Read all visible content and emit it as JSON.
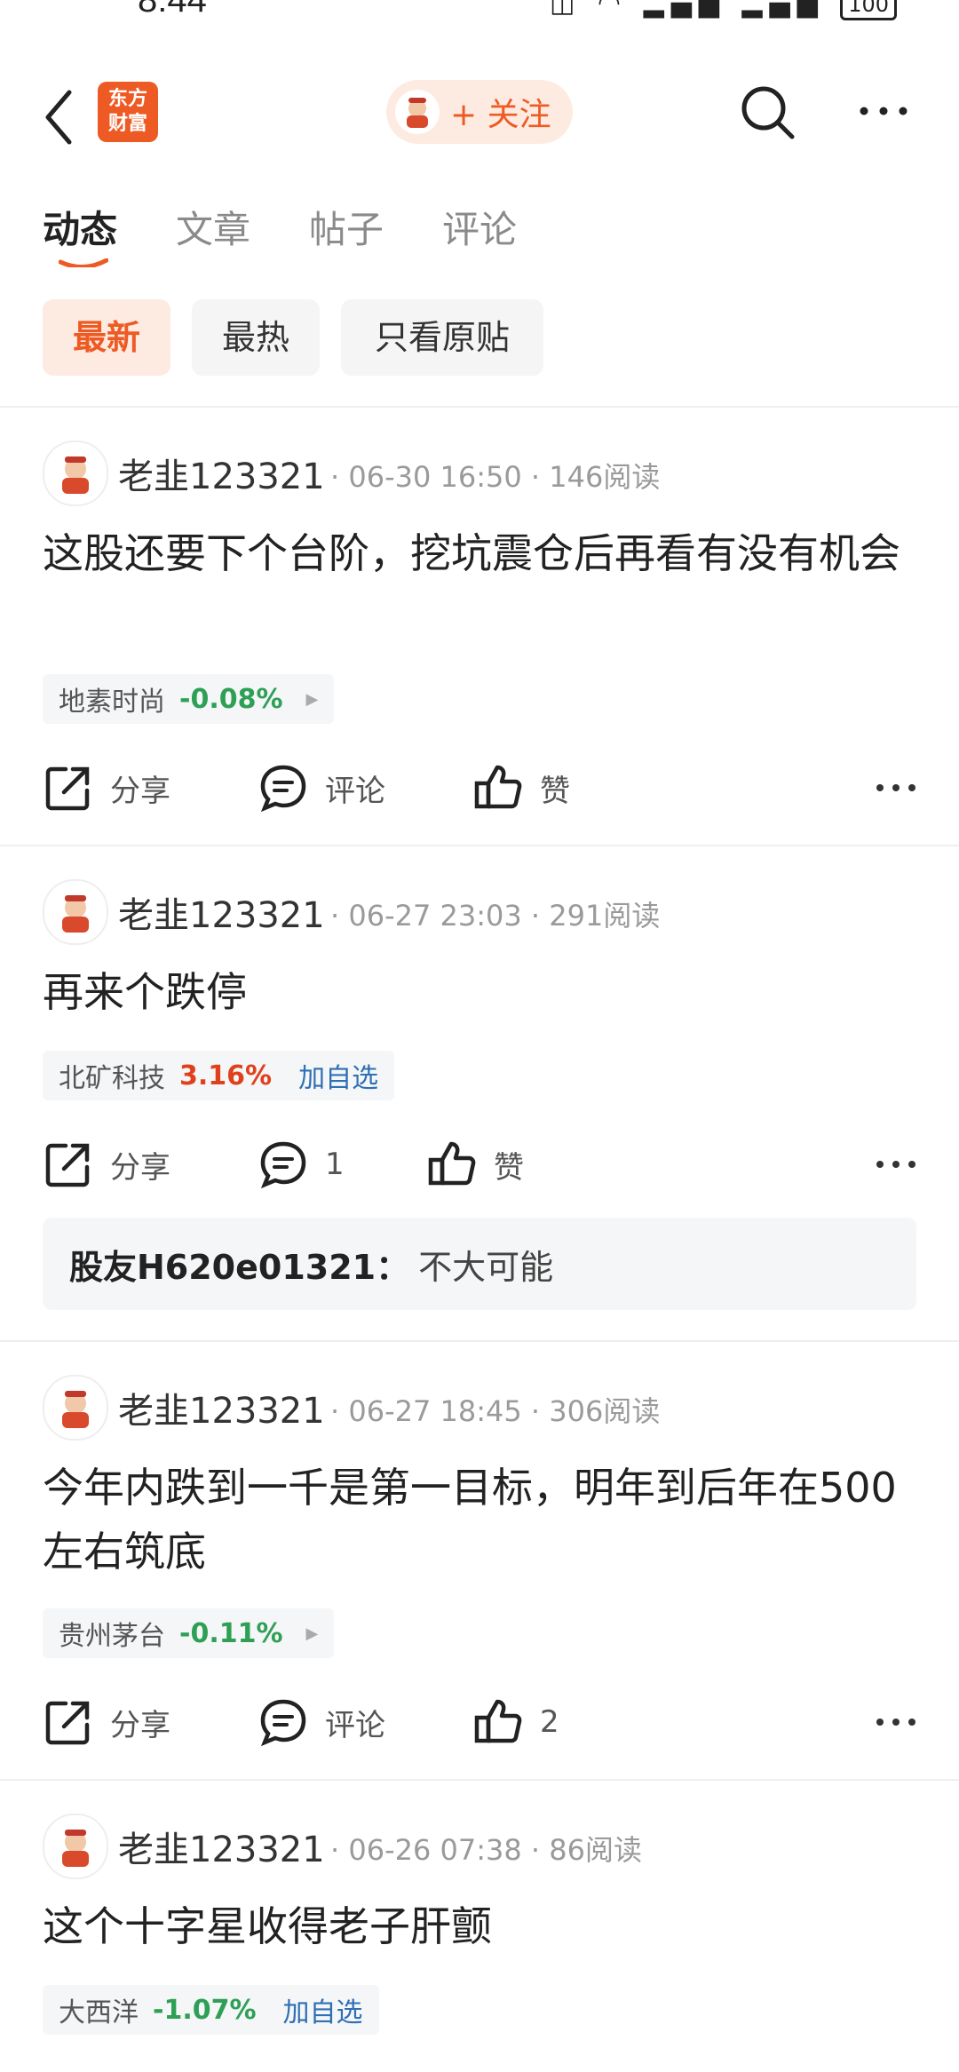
{
  "status_bar": {
    "time": "8:44",
    "battery": "100"
  },
  "header": {
    "logo_text_1": "东方",
    "logo_text_2": "财富",
    "follow_label": "+ 关注"
  },
  "tabs": [
    {
      "label": "动态"
    },
    {
      "label": "文章"
    },
    {
      "label": "帖子"
    },
    {
      "label": "评论"
    }
  ],
  "filters": [
    {
      "label": "最新"
    },
    {
      "label": "最热"
    },
    {
      "label": "只看原贴"
    }
  ],
  "posts": [
    {
      "author": "老韭123321",
      "date": "06-30 16:50",
      "reads": "146阅读",
      "text": "这股还要下个台阶，挖坑震仓后再看有没有机会",
      "stock_name": "地素时尚",
      "stock_change": "-0.08%",
      "share": "分享",
      "comment": "评论",
      "like": "赞"
    },
    {
      "author": "老韭123321",
      "date": "06-27 23:03",
      "reads": "291阅读",
      "text": "再来个跌停",
      "stock_name": "北矿科技",
      "stock_change": "3.16%",
      "stock_add": "加自选",
      "share": "分享",
      "comment": "1",
      "like": "赞",
      "reply_author": "股友H620e01321：",
      "reply_text": "不大可能"
    },
    {
      "author": "老韭123321",
      "date": "06-27 18:45",
      "reads": "306阅读",
      "text": "今年内跌到一千是第一目标，明年到后年在500左右筑底",
      "stock_name": "贵州茅台",
      "stock_change": "-0.11%",
      "share": "分享",
      "comment": "评论",
      "like": "2"
    },
    {
      "author": "老韭123321",
      "date": "06-26 07:38",
      "reads": "86阅读",
      "text": "这个十字星收得老子肝颤",
      "stock_name": "大西洋",
      "stock_change": "-1.07%",
      "stock_add": "加自选"
    }
  ],
  "colors": {
    "accent": "#ee5a24",
    "down": "#2ea056",
    "up": "#e0411d",
    "link": "#2f6fb5"
  },
  "icons": [
    "back-arrow-icon",
    "search-icon",
    "more-icon",
    "share-icon",
    "comment-icon",
    "like-icon"
  ]
}
